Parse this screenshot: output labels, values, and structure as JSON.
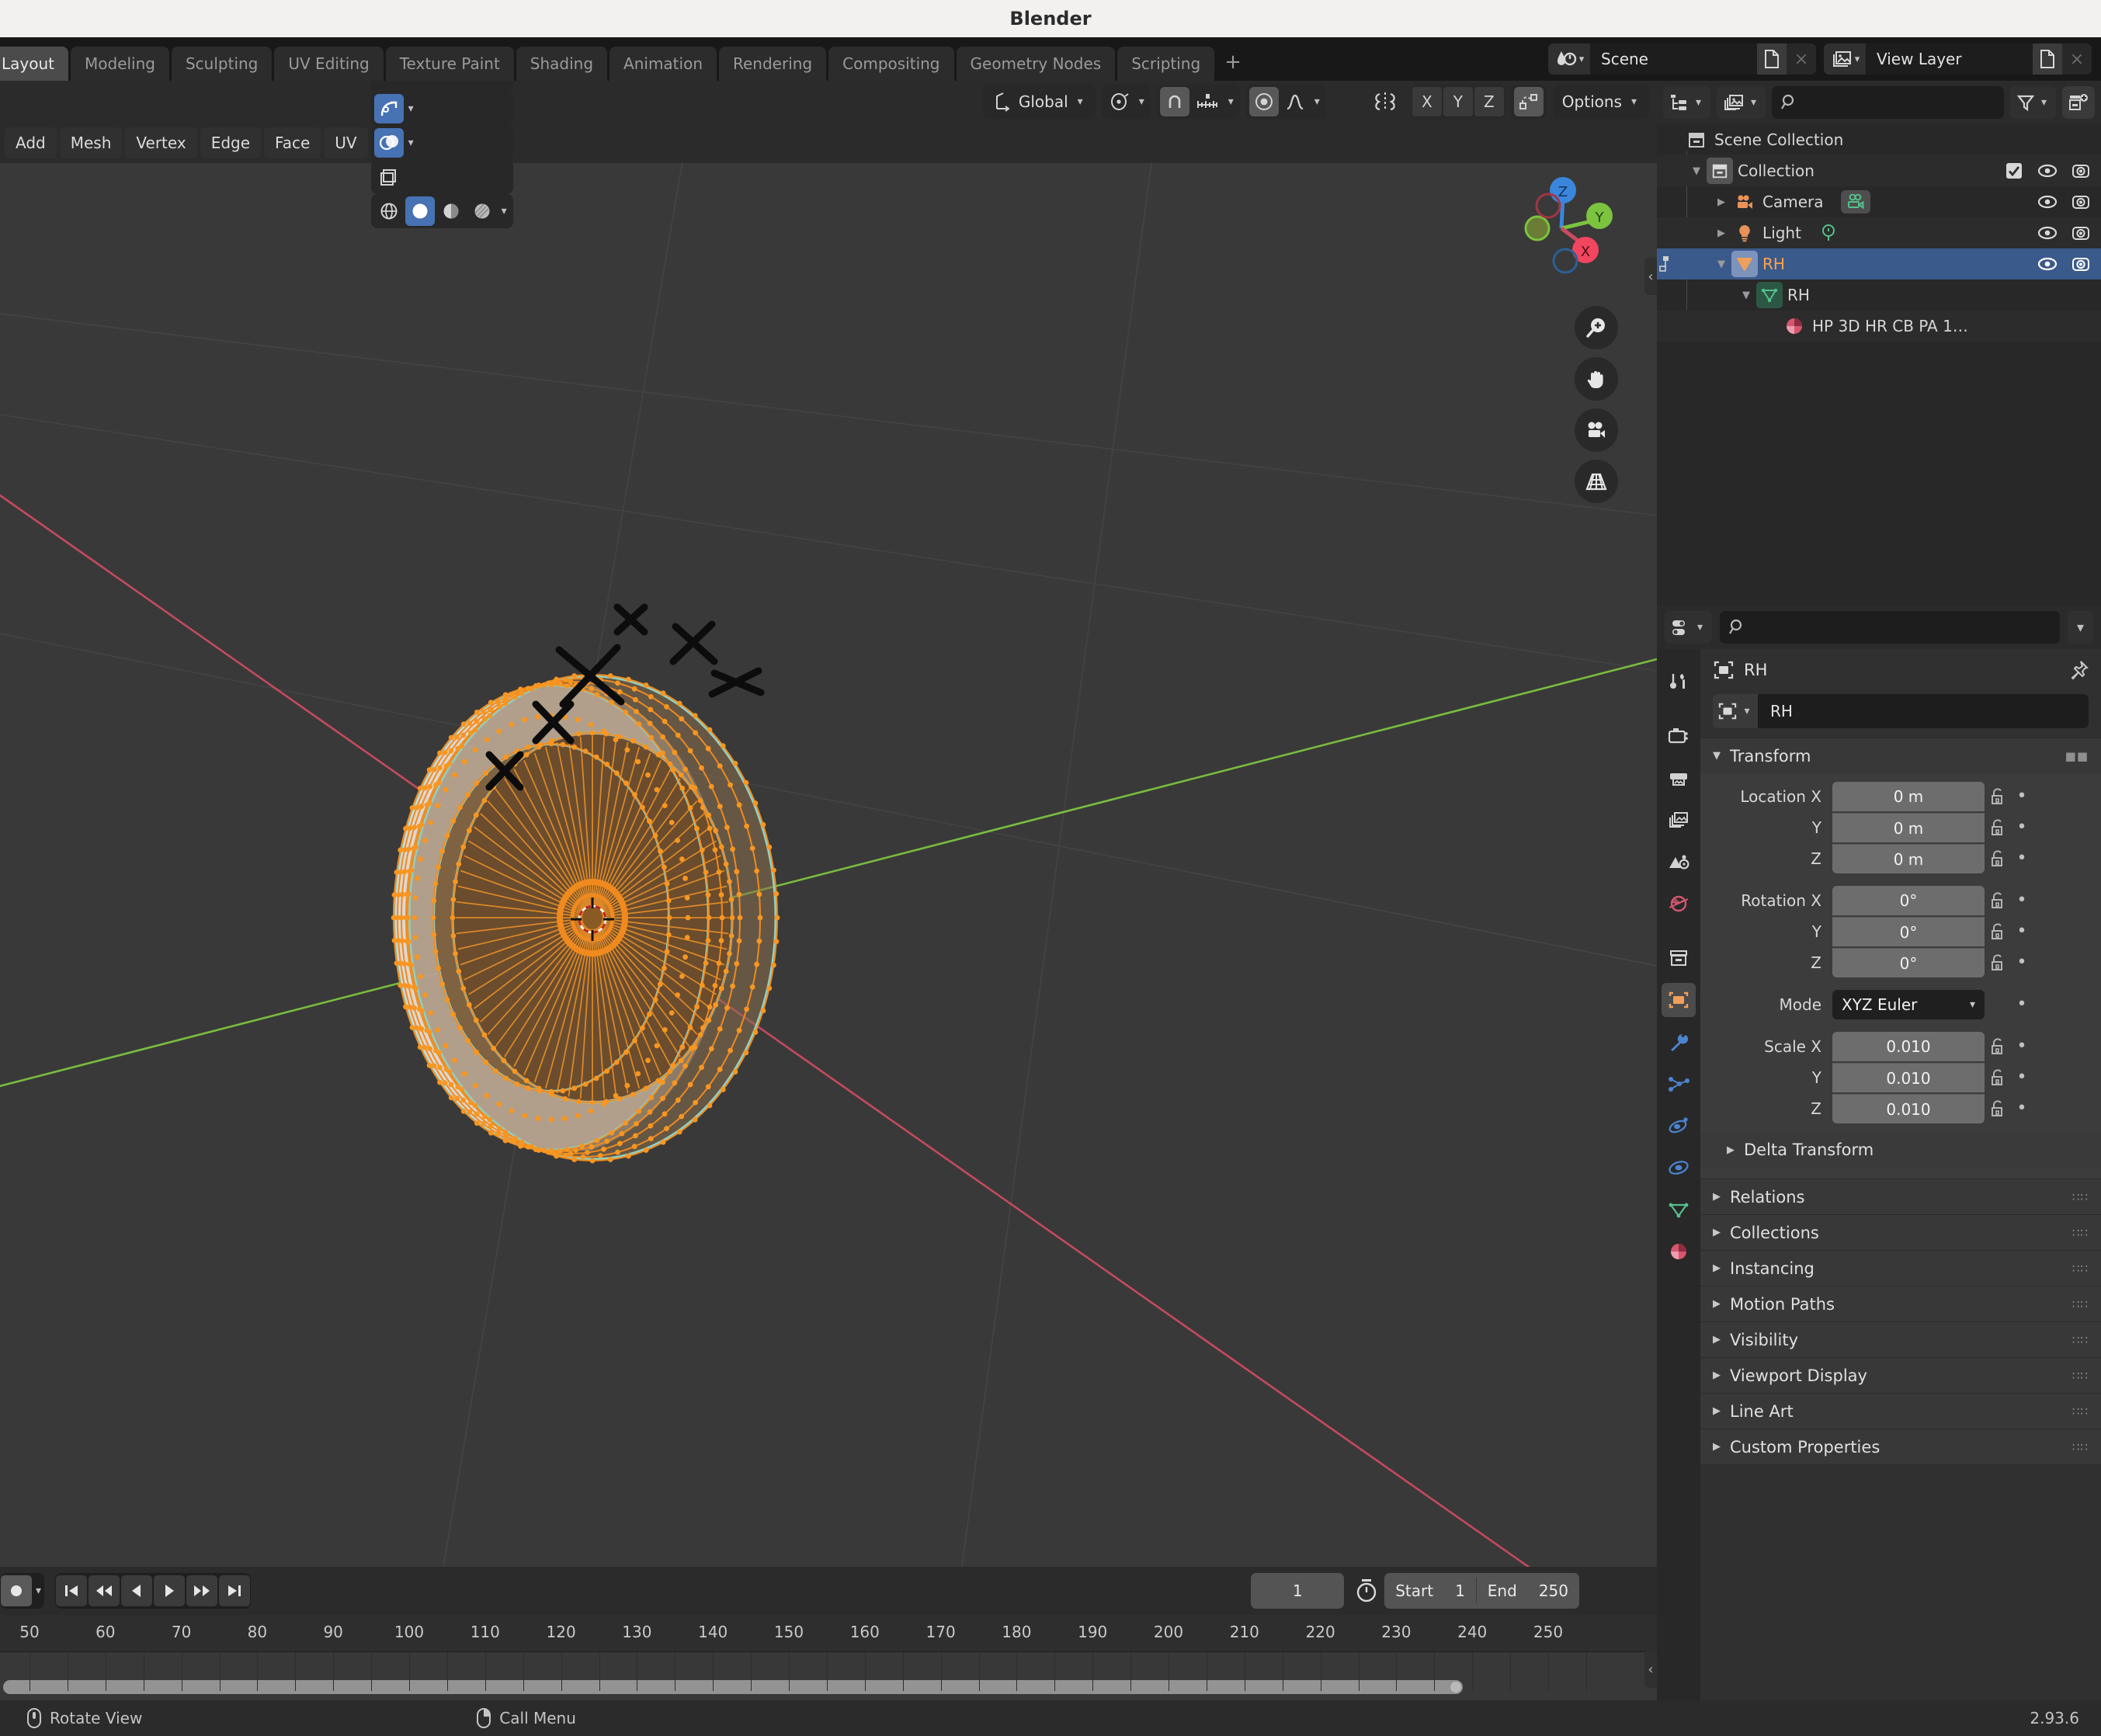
{
  "window": {
    "title": "Blender",
    "version": "2.93.6"
  },
  "topbar": {
    "workspaces": [
      {
        "label": "Layout",
        "active": true
      },
      {
        "label": "Modeling",
        "active": false
      },
      {
        "label": "Sculpting",
        "active": false
      },
      {
        "label": "UV Editing",
        "active": false
      },
      {
        "label": "Texture Paint",
        "active": false
      },
      {
        "label": "Shading",
        "active": false
      },
      {
        "label": "Animation",
        "active": false
      },
      {
        "label": "Rendering",
        "active": false
      },
      {
        "label": "Compositing",
        "active": false
      },
      {
        "label": "Geometry Nodes",
        "active": false
      },
      {
        "label": "Scripting",
        "active": false
      }
    ],
    "add_workspace_label": "+",
    "scene": {
      "name": "Scene",
      "icon": "scene-icon",
      "new_label": "new-scene-icon",
      "unlink_label": "×"
    },
    "view_layer": {
      "name": "View Layer",
      "icon": "view-layer-icon",
      "new_label": "new-layer-icon",
      "unlink_label": "×"
    }
  },
  "viewport": {
    "header": {
      "transform_orientation": "Global",
      "options_label": "Options",
      "axis_keys": [
        "X",
        "Y",
        "Z"
      ],
      "icons": [
        "transform-orientation-icon",
        "pivot-point-icon",
        "snap-magnet-icon",
        "snap-increment-icon",
        "proportional-edit-icon",
        "proportional-falloff-icon",
        "mirror-icon",
        "proportional-connected-icon"
      ]
    },
    "menus": [
      "Add",
      "Mesh",
      "Vertex",
      "Edge",
      "Face",
      "UV"
    ],
    "overlay_icons": [
      "show-gizmo-icon",
      "show-overlays-icon",
      "xray-toggle-icon",
      "shading-wireframe-icon",
      "shading-solid-icon",
      "shading-material-icon",
      "shading-rendered-icon"
    ],
    "gizmo": {
      "axes": [
        "Z",
        "Y",
        "X"
      ]
    },
    "nav_buttons": [
      "zoom-icon",
      "pan-hand-icon",
      "camera-view-icon",
      "orthographic-toggle-icon"
    ]
  },
  "timeline": {
    "playback_icons": [
      "record-icon",
      "jump-start-icon",
      "prev-keyframe-icon",
      "play-reverse-icon",
      "play-icon",
      "next-keyframe-icon",
      "jump-end-icon"
    ],
    "current_frame": "1",
    "start_label": "Start",
    "start_value": "1",
    "end_label": "End",
    "end_value": "250",
    "ruler_ticks": [
      "50",
      "60",
      "70",
      "80",
      "90",
      "100",
      "110",
      "120",
      "130",
      "140",
      "150",
      "160",
      "170",
      "180",
      "190",
      "200",
      "210",
      "220",
      "230",
      "240",
      "250"
    ]
  },
  "outliner": {
    "header": {
      "display_mode_icon": "outliner-display-mode-icon",
      "id_type_icon": "filter-id-type-icon",
      "search_placeholder": "",
      "filter_icon": "filter-funnel-icon",
      "new_collection_icon": "new-collection-icon"
    },
    "rows": [
      {
        "label": "Scene Collection",
        "indent": 0,
        "icon": "collection-icon",
        "disclosure": "",
        "selected": false,
        "orange": false,
        "checkbox": false,
        "eye": false,
        "camera": false
      },
      {
        "label": "Collection",
        "indent": 1,
        "icon": "collection-icon",
        "disclosure": "▼",
        "selected": false,
        "orange": false,
        "checkbox": true,
        "eye": true,
        "camera": true
      },
      {
        "label": "Camera",
        "indent": 2,
        "icon": "camera-object-icon",
        "disclosure": "▶",
        "selected": false,
        "orange": false,
        "checkbox": false,
        "eye": true,
        "camera": true,
        "data_icon": "camera-data-icon"
      },
      {
        "label": "Light",
        "indent": 2,
        "icon": "light-object-icon",
        "disclosure": "▶",
        "selected": false,
        "orange": false,
        "checkbox": false,
        "eye": true,
        "camera": true,
        "data_icon": "light-data-icon"
      },
      {
        "label": "RH",
        "indent": 2,
        "icon": "mesh-object-icon",
        "disclosure": "▼",
        "selected": true,
        "orange": true,
        "checkbox": false,
        "eye": true,
        "camera": true
      },
      {
        "label": "RH",
        "indent": 3,
        "icon": "mesh-data-icon",
        "disclosure": "▼",
        "selected": false,
        "orange": false,
        "checkbox": false,
        "eye": false,
        "camera": false
      },
      {
        "label": "HP 3D HR CB PA 1…",
        "indent": 4,
        "icon": "material-icon",
        "disclosure": "",
        "selected": false,
        "orange": false,
        "checkbox": false,
        "eye": false,
        "camera": false
      }
    ]
  },
  "properties": {
    "header": {
      "editor_icon": "properties-editor-icon",
      "search_placeholder": "",
      "options_caret": "⌄"
    },
    "tabs": [
      {
        "name": "tool-tab",
        "active": false
      },
      {
        "name": "render-tab",
        "active": false
      },
      {
        "name": "output-tab",
        "active": false
      },
      {
        "name": "view-layer-tab",
        "active": false
      },
      {
        "name": "scene-tab",
        "active": false
      },
      {
        "name": "world-tab",
        "active": false
      },
      {
        "name": "collection-tab",
        "active": false
      },
      {
        "name": "object-tab",
        "active": true
      },
      {
        "name": "modifier-tab",
        "active": false
      },
      {
        "name": "particles-tab",
        "active": false
      },
      {
        "name": "physics-tab",
        "active": false
      },
      {
        "name": "constraints-tab",
        "active": false
      },
      {
        "name": "object-data-tab",
        "active": false
      },
      {
        "name": "material-tab",
        "active": false
      }
    ],
    "breadcrumb": "RH",
    "object_name": "RH",
    "transform": {
      "title": "Transform",
      "location": {
        "label": "Location X",
        "labels": [
          "Location X",
          "Y",
          "Z"
        ],
        "values": [
          "0 m",
          "0 m",
          "0 m"
        ]
      },
      "rotation": {
        "labels": [
          "Rotation X",
          "Y",
          "Z"
        ],
        "values": [
          "0°",
          "0°",
          "0°"
        ]
      },
      "mode": {
        "label": "Mode",
        "value": "XYZ Euler"
      },
      "scale": {
        "labels": [
          "Scale X",
          "Y",
          "Z"
        ],
        "values": [
          "0.010",
          "0.010",
          "0.010"
        ]
      }
    },
    "panels": [
      {
        "label": "Delta Transform",
        "sub": true
      },
      {
        "label": "Relations",
        "sub": false
      },
      {
        "label": "Collections",
        "sub": false
      },
      {
        "label": "Instancing",
        "sub": false
      },
      {
        "label": "Motion Paths",
        "sub": false
      },
      {
        "label": "Visibility",
        "sub": false
      },
      {
        "label": "Viewport Display",
        "sub": false
      },
      {
        "label": "Line Art",
        "sub": false
      },
      {
        "label": "Custom Properties",
        "sub": false
      }
    ]
  },
  "statusbar": {
    "items": [
      {
        "icon": "mouse-middle-icon",
        "label": "Rotate View"
      },
      {
        "icon": "mouse-right-icon",
        "label": "Call Menu"
      }
    ],
    "version": "2.93.6"
  },
  "colors": {
    "accent_blue": "#4772b3",
    "select_orange": "#ffa14a",
    "viewport_bg": "#393939",
    "panel_bg": "#303030",
    "header_bg": "#2b2b2b",
    "axis_x_red": "#cb4b60",
    "axis_y_green": "#7cc33f",
    "axis_z_blue": "#3a86dd"
  }
}
